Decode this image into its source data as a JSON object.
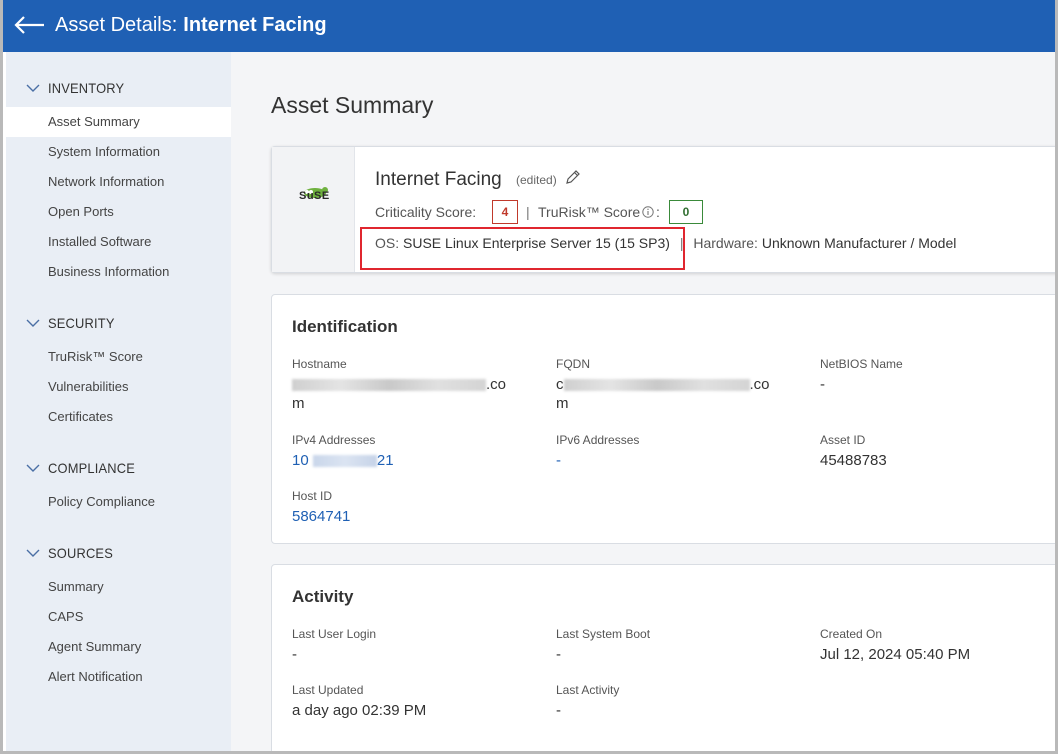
{
  "header": {
    "title_prefix": "Asset Details:",
    "title_asset": "Internet Facing"
  },
  "sidebar": {
    "sections": [
      {
        "label": "INVENTORY"
      },
      {
        "label": "SECURITY"
      },
      {
        "label": "COMPLIANCE"
      },
      {
        "label": "SOURCES"
      }
    ],
    "inventory_items": [
      "Asset Summary",
      "System Information",
      "Network Information",
      "Open Ports",
      "Installed Software",
      "Business Information"
    ],
    "security_items": [
      "TruRisk™ Score",
      "Vulnerabilities",
      "Certificates"
    ],
    "compliance_items": [
      "Policy Compliance"
    ],
    "sources_items": [
      "Summary",
      "CAPS",
      "Agent Summary",
      "Alert Notification"
    ],
    "active_item": "Asset Summary"
  },
  "main": {
    "page_title": "Asset Summary",
    "summary": {
      "logo_text": "SuSE",
      "asset_name": "Internet Facing",
      "edited": "(edited)",
      "criticality_label": "Criticality Score:",
      "criticality_value": "4",
      "separator": "|",
      "trurisk_label": "TruRisk™ Score",
      "trurisk_colon": ":",
      "trurisk_value": "0",
      "os_label": "OS:",
      "os_value": "SUSE Linux Enterprise Server 15 (15 SP3)",
      "hardware_label": "Hardware:",
      "hardware_value": "Unknown Manufacturer / Model"
    },
    "identification": {
      "title": "Identification",
      "hostname_label": "Hostname",
      "hostname_suffix": ".co",
      "hostname_line2": "m",
      "fqdn_label": "FQDN",
      "fqdn_prefix": "c",
      "fqdn_suffix": ".co",
      "fqdn_line2": "m",
      "netbios_label": "NetBIOS Name",
      "netbios_value": "-",
      "ipv4_label": "IPv4 Addresses",
      "ipv4_prefix": "10",
      "ipv4_suffix": "21",
      "ipv6_label": "IPv6 Addresses",
      "ipv6_value": "-",
      "asset_id_label": "Asset ID",
      "asset_id_value": "45488783",
      "host_id_label": "Host ID",
      "host_id_value": "5864741"
    },
    "activity": {
      "title": "Activity",
      "last_user_login_label": "Last User Login",
      "last_user_login_value": "-",
      "last_system_boot_label": "Last System Boot",
      "last_system_boot_value": "-",
      "created_on_label": "Created On",
      "created_on_value": "Jul 12, 2024 05:40 PM",
      "last_updated_label": "Last Updated",
      "last_updated_value": "a day ago 02:39 PM",
      "last_activity_label": "Last Activity",
      "last_activity_value": "-"
    }
  },
  "colors": {
    "header_bg": "#1f60b4",
    "sidebar_bg": "#e9eef5",
    "link": "#1f60b4",
    "criticality": "#c0392b",
    "trurisk": "#3a8a3a",
    "highlight": "#e0262f"
  },
  "icons": [
    "back-arrow-icon",
    "chevron-down-icon",
    "pencil-icon",
    "info-icon",
    "suse-logo"
  ]
}
